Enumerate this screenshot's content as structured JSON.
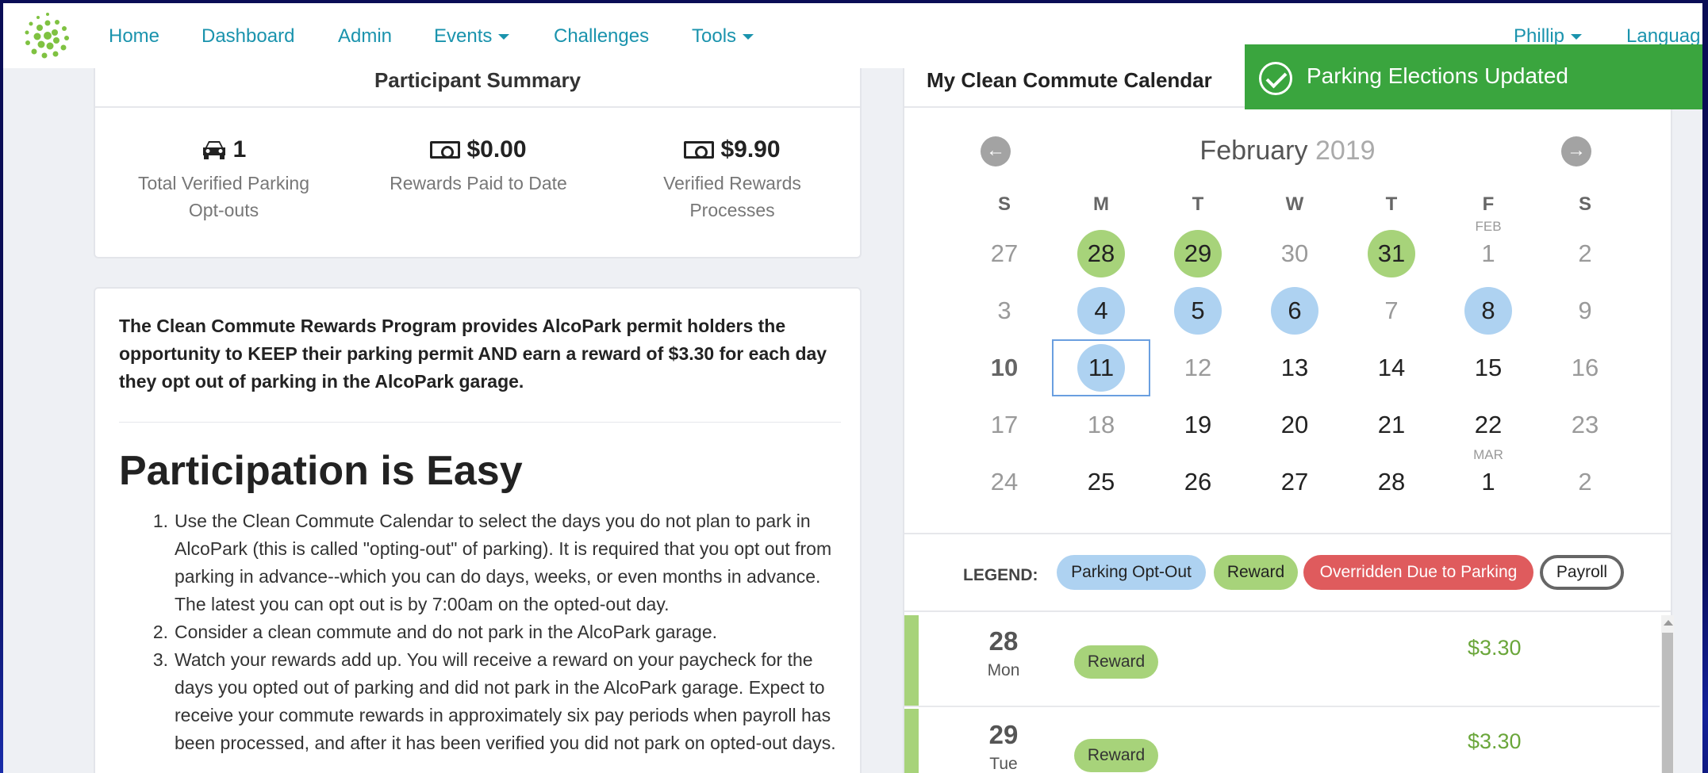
{
  "nav": {
    "home": "Home",
    "dashboard": "Dashboard",
    "admin": "Admin",
    "events": "Events",
    "challenges": "Challenges",
    "tools": "Tools",
    "user": "Phillip",
    "language": "Languag"
  },
  "summary": {
    "title": "Participant Summary",
    "stats": [
      {
        "icon": "car-icon",
        "value": "1",
        "label_line1": "Total Verified Parking",
        "label_line2": "Opt-outs"
      },
      {
        "icon": "money-icon",
        "value": "$0.00",
        "label_line1": "Rewards Paid to Date",
        "label_line2": ""
      },
      {
        "icon": "money-icon",
        "value": "$9.90",
        "label_line1": "Verified Rewards",
        "label_line2": "Processes"
      }
    ]
  },
  "info": {
    "intro": "The Clean Commute Rewards Program provides AlcoPark permit holders the opportunity to KEEP their parking permit AND earn a reward of $3.30 for each day they opt out of parking in the AlcoPark garage.",
    "heading": "Participation is Easy",
    "steps": [
      "Use the Clean Commute Calendar to select the days you do not plan to park in AlcoPark (this is called \"opting-out\" of parking). It is required that you opt out from parking in advance--which you can do days, weeks, or even months in advance. The latest you can opt out is by 7:00am on the opted-out day.",
      "Consider a clean commute and do not park in the AlcoPark garage.",
      "Watch your rewards add up. You will receive a reward on your paycheck for the days you opted out of parking and did not park in the AlcoPark garage. Expect to receive your commute rewards in approximately six pay periods when payroll has been processed, and after it has been verified you did not park on opted-out days."
    ]
  },
  "calendar": {
    "title": "My Clean Commute Calendar",
    "month": "February",
    "year": "2019",
    "weekdays": [
      "S",
      "M",
      "T",
      "W",
      "T",
      "F",
      "S"
    ],
    "feb_mark": "FEB",
    "mar_mark": "MAR",
    "weeks": [
      [
        {
          "d": "27",
          "s": "muted"
        },
        {
          "d": "28",
          "s": "green"
        },
        {
          "d": "29",
          "s": "green"
        },
        {
          "d": "30",
          "s": "muted"
        },
        {
          "d": "31",
          "s": "green"
        },
        {
          "d": "1",
          "s": "muted"
        },
        {
          "d": "2",
          "s": "muted"
        }
      ],
      [
        {
          "d": "3",
          "s": "muted"
        },
        {
          "d": "4",
          "s": "blue"
        },
        {
          "d": "5",
          "s": "blue"
        },
        {
          "d": "6",
          "s": "blue"
        },
        {
          "d": "7",
          "s": "muted"
        },
        {
          "d": "8",
          "s": "blue"
        },
        {
          "d": "9",
          "s": "muted"
        }
      ],
      [
        {
          "d": "10",
          "s": "bold"
        },
        {
          "d": "11",
          "s": "blue"
        },
        {
          "d": "12",
          "s": "muted"
        },
        {
          "d": "13",
          "s": ""
        },
        {
          "d": "14",
          "s": ""
        },
        {
          "d": "15",
          "s": ""
        },
        {
          "d": "16",
          "s": "muted"
        }
      ],
      [
        {
          "d": "17",
          "s": "muted"
        },
        {
          "d": "18",
          "s": "muted"
        },
        {
          "d": "19",
          "s": ""
        },
        {
          "d": "20",
          "s": ""
        },
        {
          "d": "21",
          "s": ""
        },
        {
          "d": "22",
          "s": ""
        },
        {
          "d": "23",
          "s": "muted"
        }
      ],
      [
        {
          "d": "24",
          "s": "muted"
        },
        {
          "d": "25",
          "s": ""
        },
        {
          "d": "26",
          "s": ""
        },
        {
          "d": "27",
          "s": ""
        },
        {
          "d": "28",
          "s": ""
        },
        {
          "d": "1",
          "s": ""
        },
        {
          "d": "2",
          "s": "muted"
        }
      ]
    ],
    "legend_label": "LEGEND:",
    "legend": [
      "Parking Opt-Out",
      "Reward",
      "Overridden Due to Parking",
      "Payroll"
    ],
    "entries": [
      {
        "day": "28",
        "dow": "Mon",
        "status": "Reward",
        "amount": "$3.30"
      },
      {
        "day": "29",
        "dow": "Tue",
        "status": "Reward",
        "amount": "$3.30"
      }
    ]
  },
  "toast": {
    "message": "Parking Elections Updated"
  },
  "colors": {
    "accent": "#1a93ad",
    "reward_green": "#a7d37a",
    "optout_blue": "#aed2f1",
    "override_red": "#df5b5d",
    "toast_green": "#3aa53e"
  }
}
